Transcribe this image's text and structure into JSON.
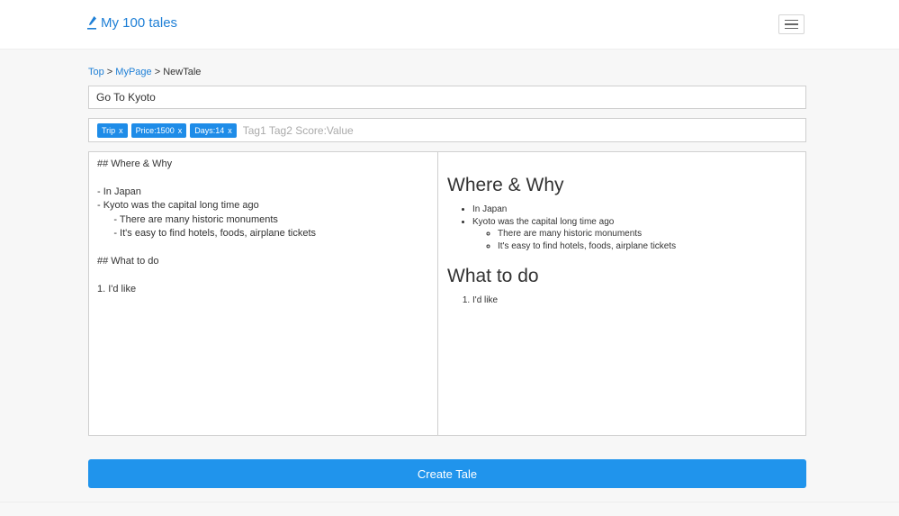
{
  "app": {
    "brand": "My 100 tales"
  },
  "breadcrumb": {
    "top": "Top",
    "sep1": " > ",
    "mypage": "MyPage",
    "sep2": " > ",
    "current": "NewTale"
  },
  "form": {
    "title_value": "Go To Kyoto",
    "tags": [
      {
        "label": "Trip",
        "remove": "x"
      },
      {
        "label": "Price:1500",
        "remove": "x"
      },
      {
        "label": "Days:14",
        "remove": "x"
      }
    ],
    "tag_placeholder": "Tag1 Tag2 Score:Value",
    "markdown": "## Where & Why\n\n- In Japan\n- Kyoto was the capital long time ago\n      - There are many historic monuments\n      - It's easy to find hotels, foods, airplane tickets\n\n## What to do\n\n1. I'd like",
    "submit_label": "Create Tale"
  },
  "preview": {
    "heading1": "Where & Why",
    "list1": [
      "In Japan",
      "Kyoto was the capital long time ago"
    ],
    "sublist": [
      "There are many historic monuments",
      "It's easy to find hotels, foods, airplane tickets"
    ],
    "heading2": "What to do",
    "list2": [
      "I'd like"
    ]
  },
  "colors": {
    "accent": "#1e7fd6",
    "button": "#2094ec",
    "tag": "#1e8ce8"
  },
  "icons": {
    "brand": "pen-icon",
    "menu": "hamburger-menu-icon"
  }
}
